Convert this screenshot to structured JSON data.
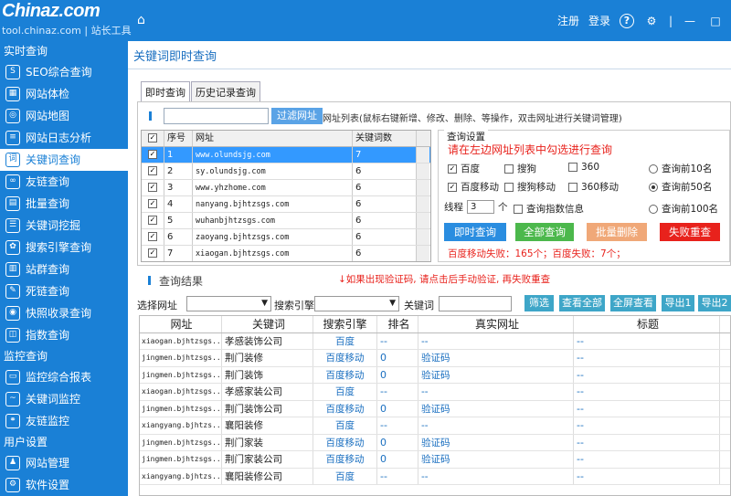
{
  "header": {
    "logo_text": "Chinaz.com",
    "logo_sub": "tool.chinaz.com | 站长工具",
    "register": "注册",
    "login": "登录",
    "help_glyph": "?"
  },
  "sidebar": {
    "sections": [
      {
        "title": "实时查询",
        "items": [
          {
            "label": "SEO综合查询",
            "icon": "seo-icon"
          },
          {
            "label": "网站体检",
            "icon": "chart-icon"
          },
          {
            "label": "网站地图",
            "icon": "globe-icon"
          },
          {
            "label": "网站日志分析",
            "icon": "log-icon"
          },
          {
            "label": "关键词查询",
            "icon": "keyword-icon",
            "active": true
          },
          {
            "label": "友链查询",
            "icon": "link-icon"
          },
          {
            "label": "批量查询",
            "icon": "batch-icon"
          },
          {
            "label": "关键词挖掘",
            "icon": "mining-icon"
          },
          {
            "label": "搜索引擎查询",
            "icon": "paw-icon"
          },
          {
            "label": "站群查询",
            "icon": "bar-icon"
          },
          {
            "label": "死链查询",
            "icon": "deadlink-icon"
          },
          {
            "label": "快照收录查询",
            "icon": "camera-icon"
          },
          {
            "label": "指数查询",
            "icon": "index-icon"
          }
        ]
      },
      {
        "title": "监控查询",
        "items": [
          {
            "label": "监控综合报表",
            "icon": "report-icon"
          },
          {
            "label": "关键词监控",
            "icon": "monitor-icon"
          },
          {
            "label": "友链监控",
            "icon": "linkmonitor-icon"
          }
        ]
      },
      {
        "title": "用户设置",
        "items": [
          {
            "label": "网站管理",
            "icon": "user-icon"
          },
          {
            "label": "软件设置",
            "icon": "settings-icon"
          }
        ]
      }
    ]
  },
  "page": {
    "title": "关键词即时查询",
    "tabs": [
      "即时查询",
      "历史记录查询"
    ]
  },
  "url_panel": {
    "filter_button": "过滤网址",
    "hint": "网址列表(鼠标右键新增、修改、删除、等操作，双击网址进行关键词管理)",
    "columns": [
      "序号",
      "网址",
      "关键词数"
    ],
    "rows": [
      {
        "no": "1",
        "url": "www.olundsjg.com",
        "count": "7",
        "selected": true
      },
      {
        "no": "2",
        "url": "sy.olundsjg.com",
        "count": "6"
      },
      {
        "no": "3",
        "url": "www.yhzhome.com",
        "count": "6"
      },
      {
        "no": "4",
        "url": "nanyang.bjhtzsgs.com",
        "count": "6"
      },
      {
        "no": "5",
        "url": "wuhanbjhtzsgs.com",
        "count": "6"
      },
      {
        "no": "6",
        "url": "zaoyang.bjhtzsgs.com",
        "count": "6"
      },
      {
        "no": "7",
        "url": "xiaogan.bjhtzsgs.com",
        "count": "6"
      }
    ]
  },
  "settings": {
    "title": "查询设置",
    "hint": "请在左边网址列表中勾选进行查询",
    "engines": [
      {
        "label": "百度",
        "checked": true
      },
      {
        "label": "搜狗",
        "checked": false
      },
      {
        "label": "360",
        "checked": false
      },
      {
        "label": "百度移动",
        "checked": true
      },
      {
        "label": "搜狗移动",
        "checked": false
      },
      {
        "label": "360移动",
        "checked": false
      }
    ],
    "ranges": [
      {
        "label": "查询前10名",
        "on": false
      },
      {
        "label": "查询前50名",
        "on": true
      },
      {
        "label": "查询前100名",
        "on": false
      }
    ],
    "thread_label": "线程",
    "thread_value": "3",
    "thread_unit": "个",
    "index_label": "查询指数信息",
    "buttons": {
      "query_now": "即时查询",
      "query_all": "全部查询",
      "batch_delete": "批量删除",
      "fail_retry": "失败重查"
    },
    "colors": {
      "query_now": "#2a8de0",
      "query_all": "#4cb84c",
      "batch_delete": "#f0a878",
      "fail_retry": "#e8221c"
    },
    "fail_text": "百度移动失败：165个；百度失败：7个；"
  },
  "results": {
    "title": "查询结果",
    "warning": "↓如果出现验证码, 请点击后手动验证, 再失败重查",
    "filter": {
      "site_label": "选择网址",
      "engine_label": "搜索引擎",
      "keyword_label": "关键词",
      "buttons": [
        "筛选",
        "查看全部",
        "全屏查看",
        "导出1",
        "导出2"
      ]
    },
    "columns": [
      "网址",
      "关键词",
      "搜索引擎",
      "排名",
      "真实网址",
      "标题"
    ],
    "rows": [
      {
        "url": "xiaogan.bjhtzsgs...",
        "kw": "孝感装饰公司",
        "se": "百度",
        "rank": "--",
        "real": "--",
        "title": "--"
      },
      {
        "url": "jingmen.bjhtzsgs...",
        "kw": "荆门装修",
        "se": "百度移动",
        "rank": "0",
        "real": "验证码",
        "title": "--"
      },
      {
        "url": "jingmen.bjhtzsgs...",
        "kw": "荆门装饰",
        "se": "百度移动",
        "rank": "0",
        "real": "验证码",
        "title": "--"
      },
      {
        "url": "xiaogan.bjhtzsgs...",
        "kw": "孝感家装公司",
        "se": "百度",
        "rank": "--",
        "real": "--",
        "title": "--"
      },
      {
        "url": "jingmen.bjhtzsgs...",
        "kw": "荆门装饰公司",
        "se": "百度移动",
        "rank": "0",
        "real": "验证码",
        "title": "--"
      },
      {
        "url": "xiangyang.bjhtzs...",
        "kw": "襄阳装修",
        "se": "百度",
        "rank": "--",
        "real": "--",
        "title": "--"
      },
      {
        "url": "jingmen.bjhtzsgs...",
        "kw": "荆门家装",
        "se": "百度移动",
        "rank": "0",
        "real": "验证码",
        "title": "--"
      },
      {
        "url": "jingmen.bjhtzsgs...",
        "kw": "荆门家装公司",
        "se": "百度移动",
        "rank": "0",
        "real": "验证码",
        "title": "--"
      },
      {
        "url": "xiangyang.bjhtzs...",
        "kw": "襄阳装修公司",
        "se": "百度",
        "rank": "--",
        "real": "--",
        "title": "--"
      }
    ]
  }
}
